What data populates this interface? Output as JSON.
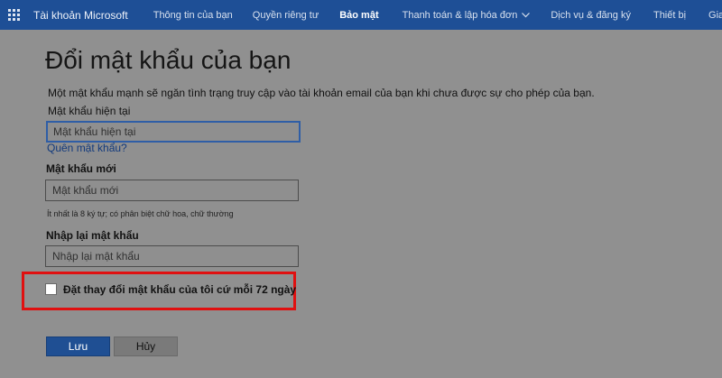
{
  "header": {
    "app_launcher_icon": "waffle-grid-icon",
    "brand": "Tài khoản Microsoft",
    "nav": [
      {
        "label": "Thông tin của bạn",
        "active": false
      },
      {
        "label": "Quyền riêng tư",
        "active": false
      },
      {
        "label": "Bảo mật",
        "active": true
      },
      {
        "label": "Thanh toán & lập hóa đơn",
        "active": false,
        "dropdown": true
      },
      {
        "label": "Dịch vụ & đăng ký",
        "active": false
      },
      {
        "label": "Thiết bị",
        "active": false
      },
      {
        "label": "Gia đình",
        "active": false
      }
    ]
  },
  "page": {
    "title": "Đổi mật khẩu của bạn",
    "intro": "Một mật khẩu mạnh sẽ ngăn tình trạng truy cập vào tài khoản email của bạn khi chưa được sự cho phép của bạn."
  },
  "form": {
    "current": {
      "label": "Mật khẩu hiện tại",
      "placeholder": "Mật khẩu hiện tại",
      "value": ""
    },
    "forgot_link": "Quên mật khẩu?",
    "new": {
      "label": "Mật khẩu mới",
      "placeholder": "Mật khẩu mới",
      "value": "",
      "hint": "Ít nhất là 8 ký tự; có phân biệt chữ hoa, chữ thường"
    },
    "confirm": {
      "label": "Nhập lại mật khẩu",
      "placeholder": "Nhập lại mật khẩu",
      "value": ""
    },
    "expire_checkbox": {
      "label": "Đặt thay đổi mật khẩu của tôi cứ mỗi 72 ngày",
      "checked": false
    },
    "save_label": "Lưu",
    "cancel_label": "Hủy"
  },
  "colors": {
    "header_bg": "#1e4f96",
    "overlay_bg": "#909090",
    "highlight": "#e01010",
    "primary_button": "#1f4f93"
  }
}
